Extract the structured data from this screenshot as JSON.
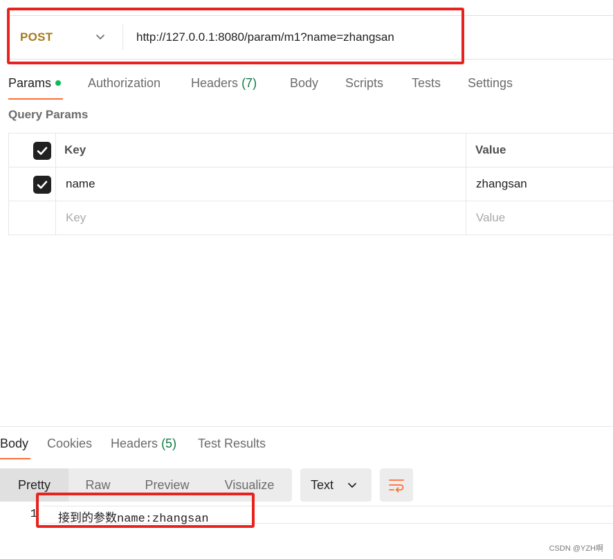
{
  "request": {
    "method": "POST",
    "url": "http://127.0.0.1:8080/param/m1?name=zhangsan"
  },
  "request_tabs": [
    {
      "label": "Params",
      "active": true,
      "has_dot": true
    },
    {
      "label": "Authorization"
    },
    {
      "label": "Headers",
      "count": "(7)"
    },
    {
      "label": "Body"
    },
    {
      "label": "Scripts"
    },
    {
      "label": "Tests"
    },
    {
      "label": "Settings"
    }
  ],
  "query_params": {
    "title": "Query Params",
    "columns": {
      "key": "Key",
      "value": "Value"
    },
    "rows": [
      {
        "checked": true,
        "key": "name",
        "value": "zhangsan"
      }
    ],
    "placeholder": {
      "key": "Key",
      "value": "Value"
    }
  },
  "response": {
    "tabs": [
      {
        "label": "Body",
        "active": true
      },
      {
        "label": "Cookies"
      },
      {
        "label": "Headers",
        "count": "(5)"
      },
      {
        "label": "Test Results"
      }
    ],
    "formats": [
      "Pretty",
      "Raw",
      "Preview",
      "Visualize"
    ],
    "active_format": "Pretty",
    "type_select": "Text",
    "line_number": "1",
    "body_text": "接到的参数name:zhangsan"
  },
  "watermark": "CSDN @YZH啊",
  "colors": {
    "accent": "#ff6c37",
    "method_post": "#a6791a",
    "count_green": "#0c7a43",
    "annotation_red": "#e8231d"
  }
}
